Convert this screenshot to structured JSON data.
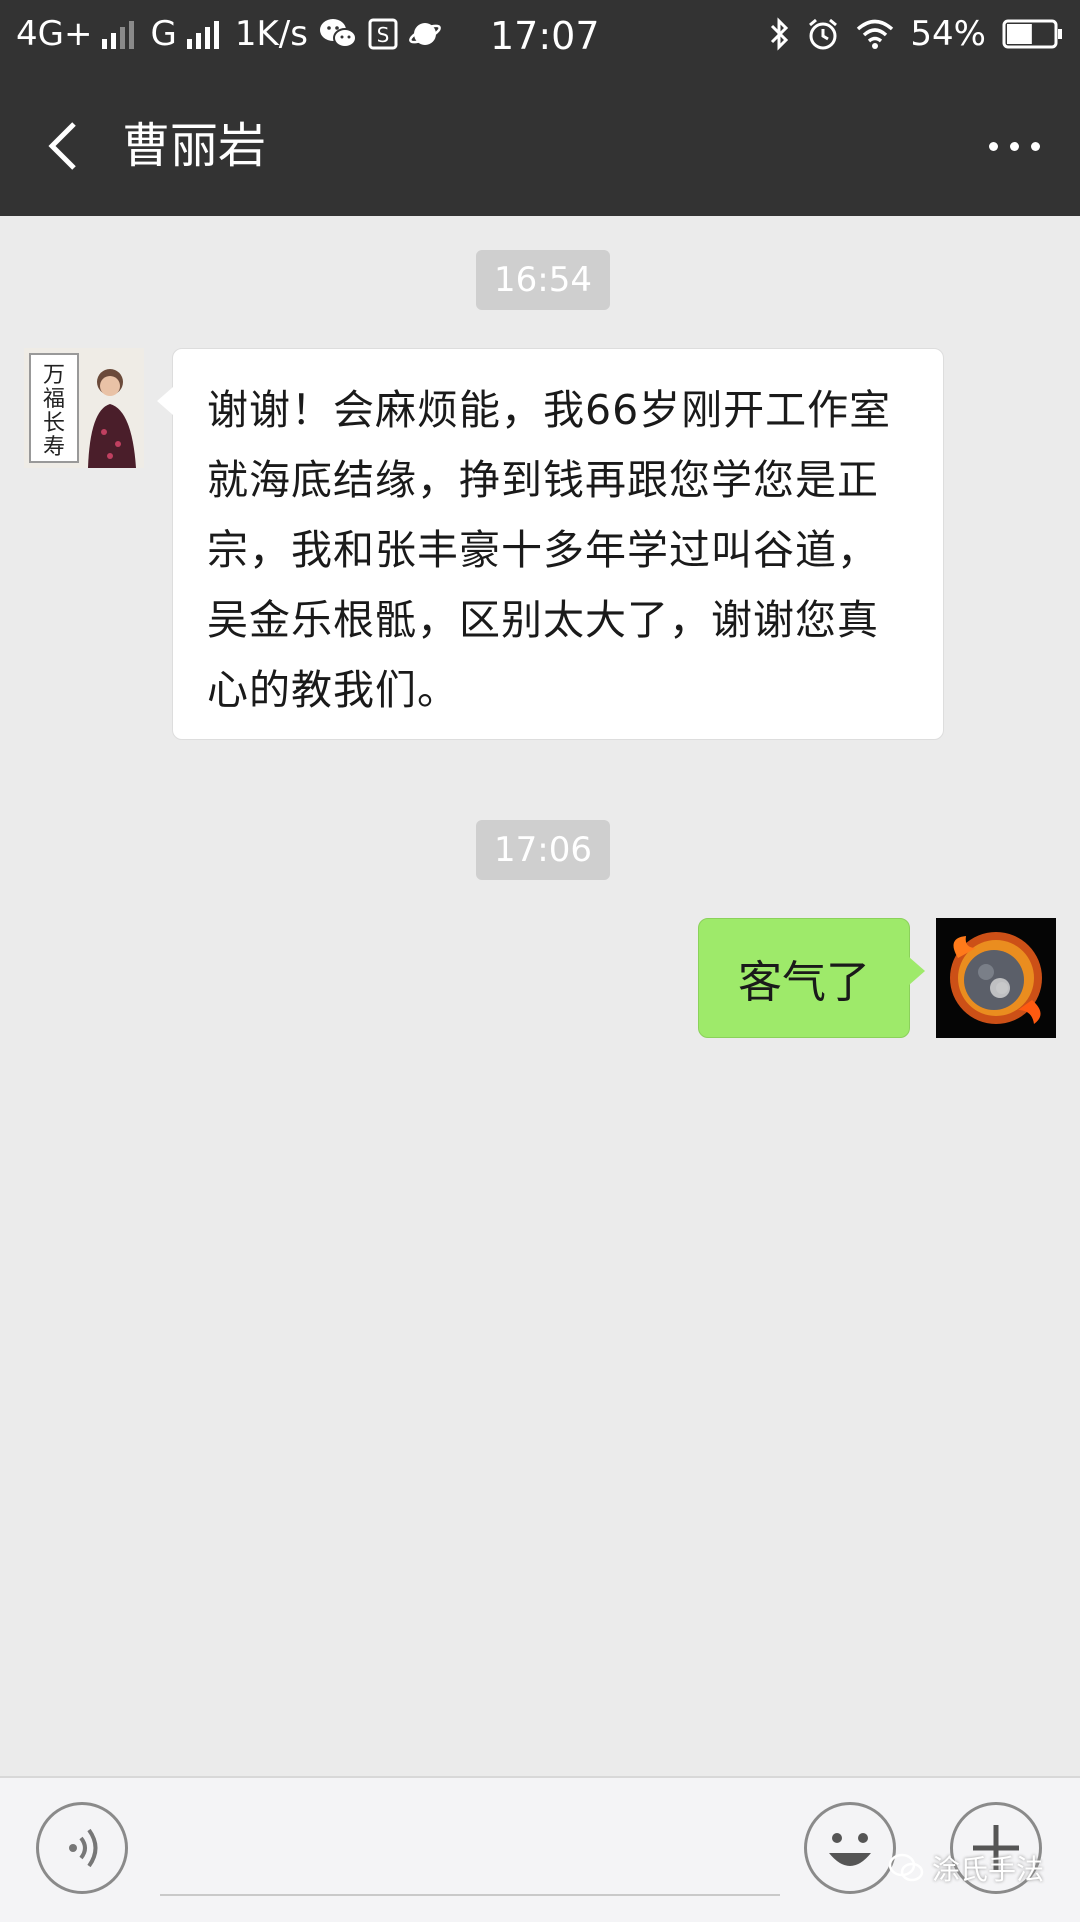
{
  "status_bar": {
    "network1": "4G+",
    "network2": "G",
    "speed": "1K/s",
    "time": "17:07",
    "battery": "54%",
    "battery_level": 0.54
  },
  "header": {
    "title": "曹丽岩",
    "back_icon": "chevron-left-icon",
    "more_icon": "more-dots-icon"
  },
  "chat": {
    "messages": [
      {
        "type": "time",
        "text": "16:54"
      },
      {
        "type": "received",
        "text": "谢谢！会麻烦能，我66岁刚开工作室就海底结缘，挣到钱再跟您学您是正宗，我和张丰豪十多年学过叫谷道，吴金乐根骶，区别太大了，谢谢您真心的教我们。"
      },
      {
        "type": "time",
        "text": "17:06"
      },
      {
        "type": "sent",
        "text": "客气了"
      }
    ]
  },
  "avatar_artwork_text": "万福长寿",
  "input_bar": {
    "voice_icon": "voice-icon",
    "emoji_icon": "emoji-icon",
    "plus_icon": "plus-icon"
  },
  "watermark": {
    "text": "涂氏手法"
  },
  "colors": {
    "header_bg": "#333333",
    "chat_bg": "#ebebeb",
    "sent_bubble": "#9eea6a",
    "received_bubble": "#ffffff",
    "time_pill": "#cfcfcf"
  }
}
